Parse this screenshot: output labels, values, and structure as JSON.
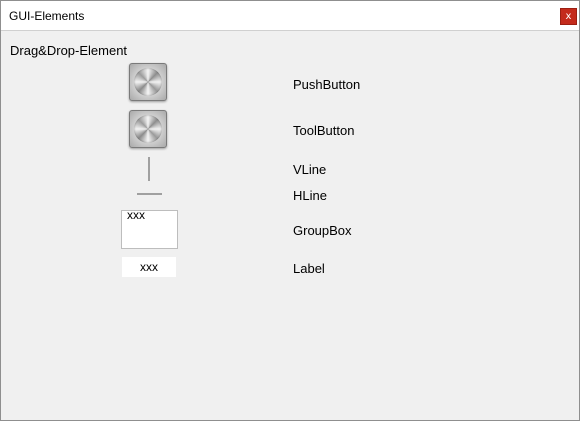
{
  "window": {
    "title": "GUI-Elements",
    "close_glyph": "x",
    "accent_close": "#c42b1c"
  },
  "panel": {
    "section_label": "Drag&Drop-Element",
    "items": [
      {
        "label": "PushButton",
        "icon": "metal-knob-icon"
      },
      {
        "label": "ToolButton",
        "icon": "metal-knob-icon"
      },
      {
        "label": "VLine",
        "icon": "vertical-line-icon"
      },
      {
        "label": "HLine",
        "icon": "horizontal-line-icon"
      },
      {
        "label": "GroupBox",
        "preview_text": "xxx"
      },
      {
        "label": "Label",
        "preview_text": "xxx"
      }
    ]
  }
}
